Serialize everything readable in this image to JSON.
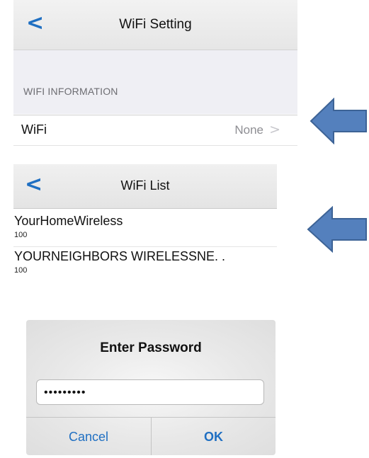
{
  "wifi_setting": {
    "title": "WiFi Setting",
    "back_glyph": "<",
    "section_header": "WIFI INFORMATION",
    "row_label": "WiFi",
    "row_value": "None",
    "chevron_glyph": ">"
  },
  "wifi_list": {
    "title": "WiFi List",
    "back_glyph": "<",
    "networks": [
      {
        "ssid": "YourHomeWireless",
        "signal": "100"
      },
      {
        "ssid": "YOURNEIGHBORS WIRELESSNE. .",
        "signal": "100"
      }
    ]
  },
  "password_dialog": {
    "title": "Enter Password",
    "value": "•••••••••",
    "cancel_label": "Cancel",
    "ok_label": "OK"
  },
  "colors": {
    "accent": "#1f6fc2",
    "callout_arrow": "#5480bd"
  }
}
